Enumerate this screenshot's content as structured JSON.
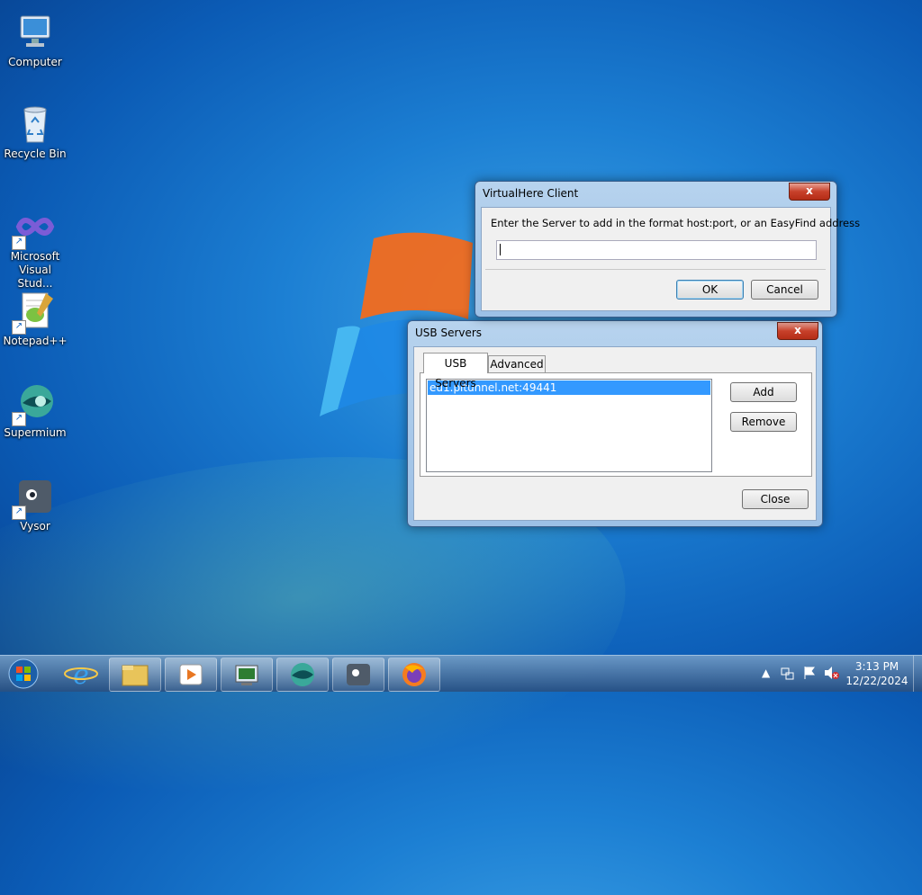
{
  "desktop": {
    "icons": [
      {
        "label": "Computer",
        "icon": "computer-icon"
      },
      {
        "label": "Recycle Bin",
        "icon": "recycle-bin-icon"
      },
      {
        "label_line1": "Microsoft",
        "label_line2": "Visual Stud...",
        "icon": "visual-studio-icon"
      },
      {
        "label": "Notepad++",
        "icon": "notepadpp-icon"
      },
      {
        "label": "Supermium",
        "icon": "supermium-icon"
      },
      {
        "label": "Vysor",
        "icon": "vysor-icon"
      }
    ]
  },
  "dialog_add_server": {
    "title": "VirtualHere Client",
    "prompt": "Enter the Server to add in the format host:port, or an EasyFind address",
    "input_value": "",
    "ok_label": "OK",
    "cancel_label": "Cancel",
    "close_glyph": "x"
  },
  "usb_servers_window": {
    "title": "USB Servers",
    "tabs": [
      "USB Servers",
      "Advanced"
    ],
    "active_tab": "USB Servers",
    "servers": [
      "eu1.pitunnel.net:49441"
    ],
    "add_label": "Add",
    "remove_label": "Remove",
    "close_label": "Close",
    "close_glyph": "x"
  },
  "taskbar": {
    "items": [
      "start-orb-icon",
      "internet-explorer-icon",
      "file-explorer-icon",
      "media-player-icon",
      "virtualhere-icon",
      "supermium-icon",
      "vysor-icon",
      "firefox-icon"
    ],
    "clock_time": "3:13 PM",
    "clock_date": "12/22/2024"
  },
  "colors": {
    "selection": "#3399ff",
    "close_button": "#c7402a"
  }
}
